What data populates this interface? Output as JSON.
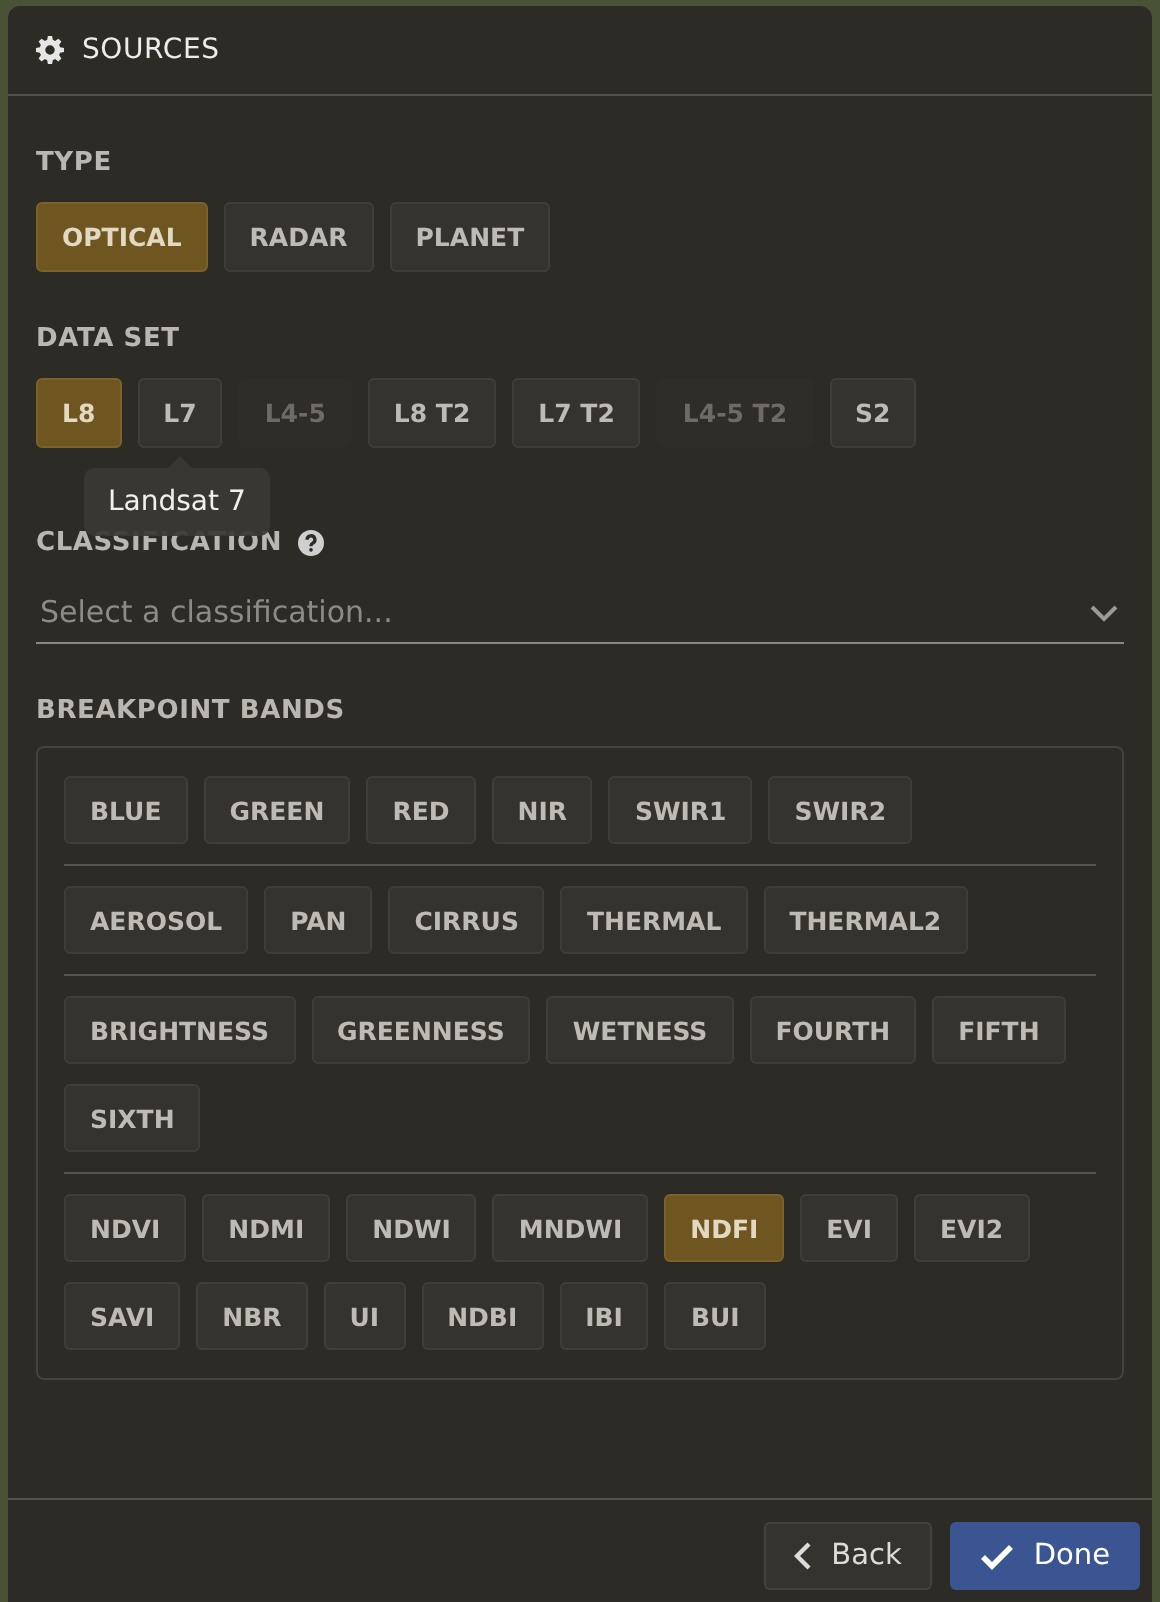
{
  "panel": {
    "title": "SOURCES"
  },
  "type": {
    "label": "TYPE",
    "options": [
      {
        "label": "OPTICAL",
        "selected": true
      },
      {
        "label": "RADAR",
        "selected": false
      },
      {
        "label": "PLANET",
        "selected": false
      }
    ]
  },
  "data_set": {
    "label": "DATA SET",
    "options": [
      {
        "label": "L8",
        "selected": true,
        "disabled": false
      },
      {
        "label": "L7",
        "selected": false,
        "disabled": false
      },
      {
        "label": "L4-5",
        "selected": false,
        "disabled": true
      },
      {
        "label": "L8 T2",
        "selected": false,
        "disabled": false
      },
      {
        "label": "L7 T2",
        "selected": false,
        "disabled": false
      },
      {
        "label": "L4-5 T2",
        "selected": false,
        "disabled": true
      },
      {
        "label": "S2",
        "selected": false,
        "disabled": false
      }
    ],
    "tooltip": "Landsat 7"
  },
  "classification": {
    "label": "CLASSIFICATION",
    "placeholder": "Select a classification..."
  },
  "breakpoint_bands": {
    "label": "BREAKPOINT BANDS",
    "groups": [
      [
        {
          "label": "BLUE",
          "selected": false
        },
        {
          "label": "GREEN",
          "selected": false
        },
        {
          "label": "RED",
          "selected": false
        },
        {
          "label": "NIR",
          "selected": false
        },
        {
          "label": "SWIR1",
          "selected": false
        },
        {
          "label": "SWIR2",
          "selected": false
        }
      ],
      [
        {
          "label": "AEROSOL",
          "selected": false
        },
        {
          "label": "PAN",
          "selected": false
        },
        {
          "label": "CIRRUS",
          "selected": false
        },
        {
          "label": "THERMAL",
          "selected": false
        },
        {
          "label": "THERMAL2",
          "selected": false
        }
      ],
      [
        {
          "label": "BRIGHTNESS",
          "selected": false
        },
        {
          "label": "GREENNESS",
          "selected": false
        },
        {
          "label": "WETNESS",
          "selected": false
        },
        {
          "label": "FOURTH",
          "selected": false
        },
        {
          "label": "FIFTH",
          "selected": false
        },
        {
          "label": "SIXTH",
          "selected": false
        }
      ],
      [
        {
          "label": "NDVI",
          "selected": false
        },
        {
          "label": "NDMI",
          "selected": false
        },
        {
          "label": "NDWI",
          "selected": false
        },
        {
          "label": "MNDWI",
          "selected": false
        },
        {
          "label": "NDFI",
          "selected": true
        },
        {
          "label": "EVI",
          "selected": false
        },
        {
          "label": "EVI2",
          "selected": false
        },
        {
          "label": "SAVI",
          "selected": false
        },
        {
          "label": "NBR",
          "selected": false
        },
        {
          "label": "UI",
          "selected": false
        },
        {
          "label": "NDBI",
          "selected": false
        },
        {
          "label": "IBI",
          "selected": false
        },
        {
          "label": "BUI",
          "selected": false
        }
      ]
    ]
  },
  "buttons": {
    "back": "Back",
    "done": "Done"
  }
}
